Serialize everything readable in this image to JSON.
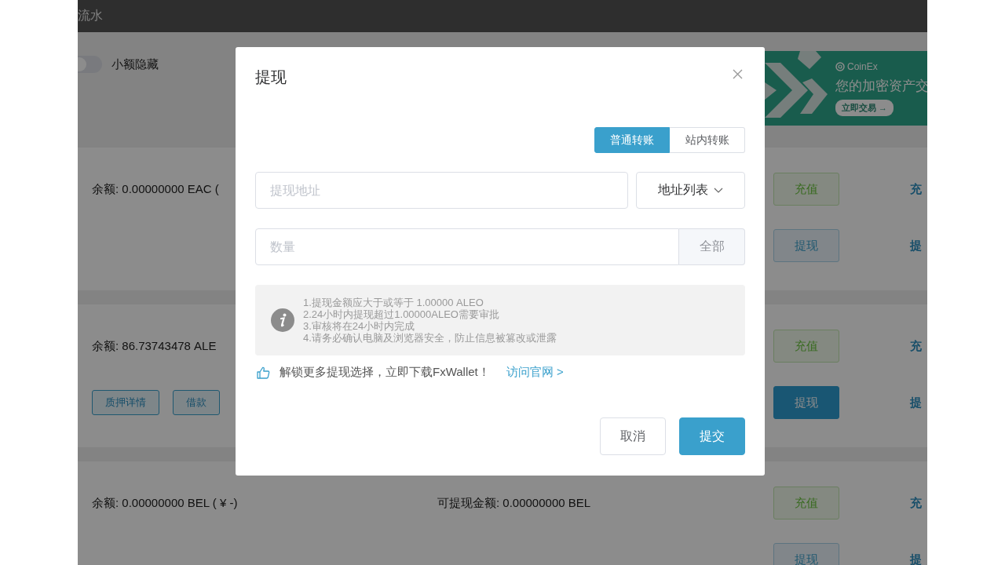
{
  "header": {
    "title": "流水"
  },
  "hide_small": {
    "label": "小额隐藏",
    "on": false
  },
  "banner": {
    "brand": "CoinEx",
    "headline": "您的加密资产交",
    "cta": "立即交易 →"
  },
  "assets": [
    {
      "balance": "余额: 0.00000000 EAC (",
      "deposit": "充值",
      "withdraw": {
        "label": "提现",
        "highlighted": false
      },
      "links": [
        "充",
        "提"
      ]
    },
    {
      "balance": "余额: 86.73743478 ALE",
      "actions": [
        "质押详情",
        "借款"
      ],
      "deposit": "充值",
      "withdraw": {
        "label": "提现",
        "highlighted": true
      },
      "links": [
        "充",
        "提"
      ]
    },
    {
      "balance": "余额: 0.00000000 BEL ( ¥ -)",
      "available": "可提现金额: 0.00000000 BEL",
      "deposit": "充值",
      "withdraw": {
        "label": "提现",
        "highlighted": false
      },
      "links": [
        "充",
        "提"
      ]
    }
  ],
  "dialog": {
    "title": "提现",
    "tabs": [
      {
        "label": "普通转账",
        "selected": true
      },
      {
        "label": "站内转账",
        "selected": false
      }
    ],
    "address": {
      "placeholder": "提现地址"
    },
    "address_list": "地址列表",
    "amount": {
      "placeholder": "数量"
    },
    "all": "全部",
    "notes": [
      "1.提现金额应大于或等于 1.00000 ALEO",
      "2.24小时内提现超过1.00000ALEO需要审批",
      "3.审核将在24小时内完成",
      "4.请务必确认电脑及浏览器安全，防止信息被篡改或泄露"
    ],
    "promo": {
      "text": "解锁更多提现选择，立即下载FxWallet！",
      "link": "访问官网 >"
    },
    "buttons": [
      {
        "label": "取消",
        "kind": "secondary"
      },
      {
        "label": "提交",
        "kind": "primary"
      }
    ]
  }
}
